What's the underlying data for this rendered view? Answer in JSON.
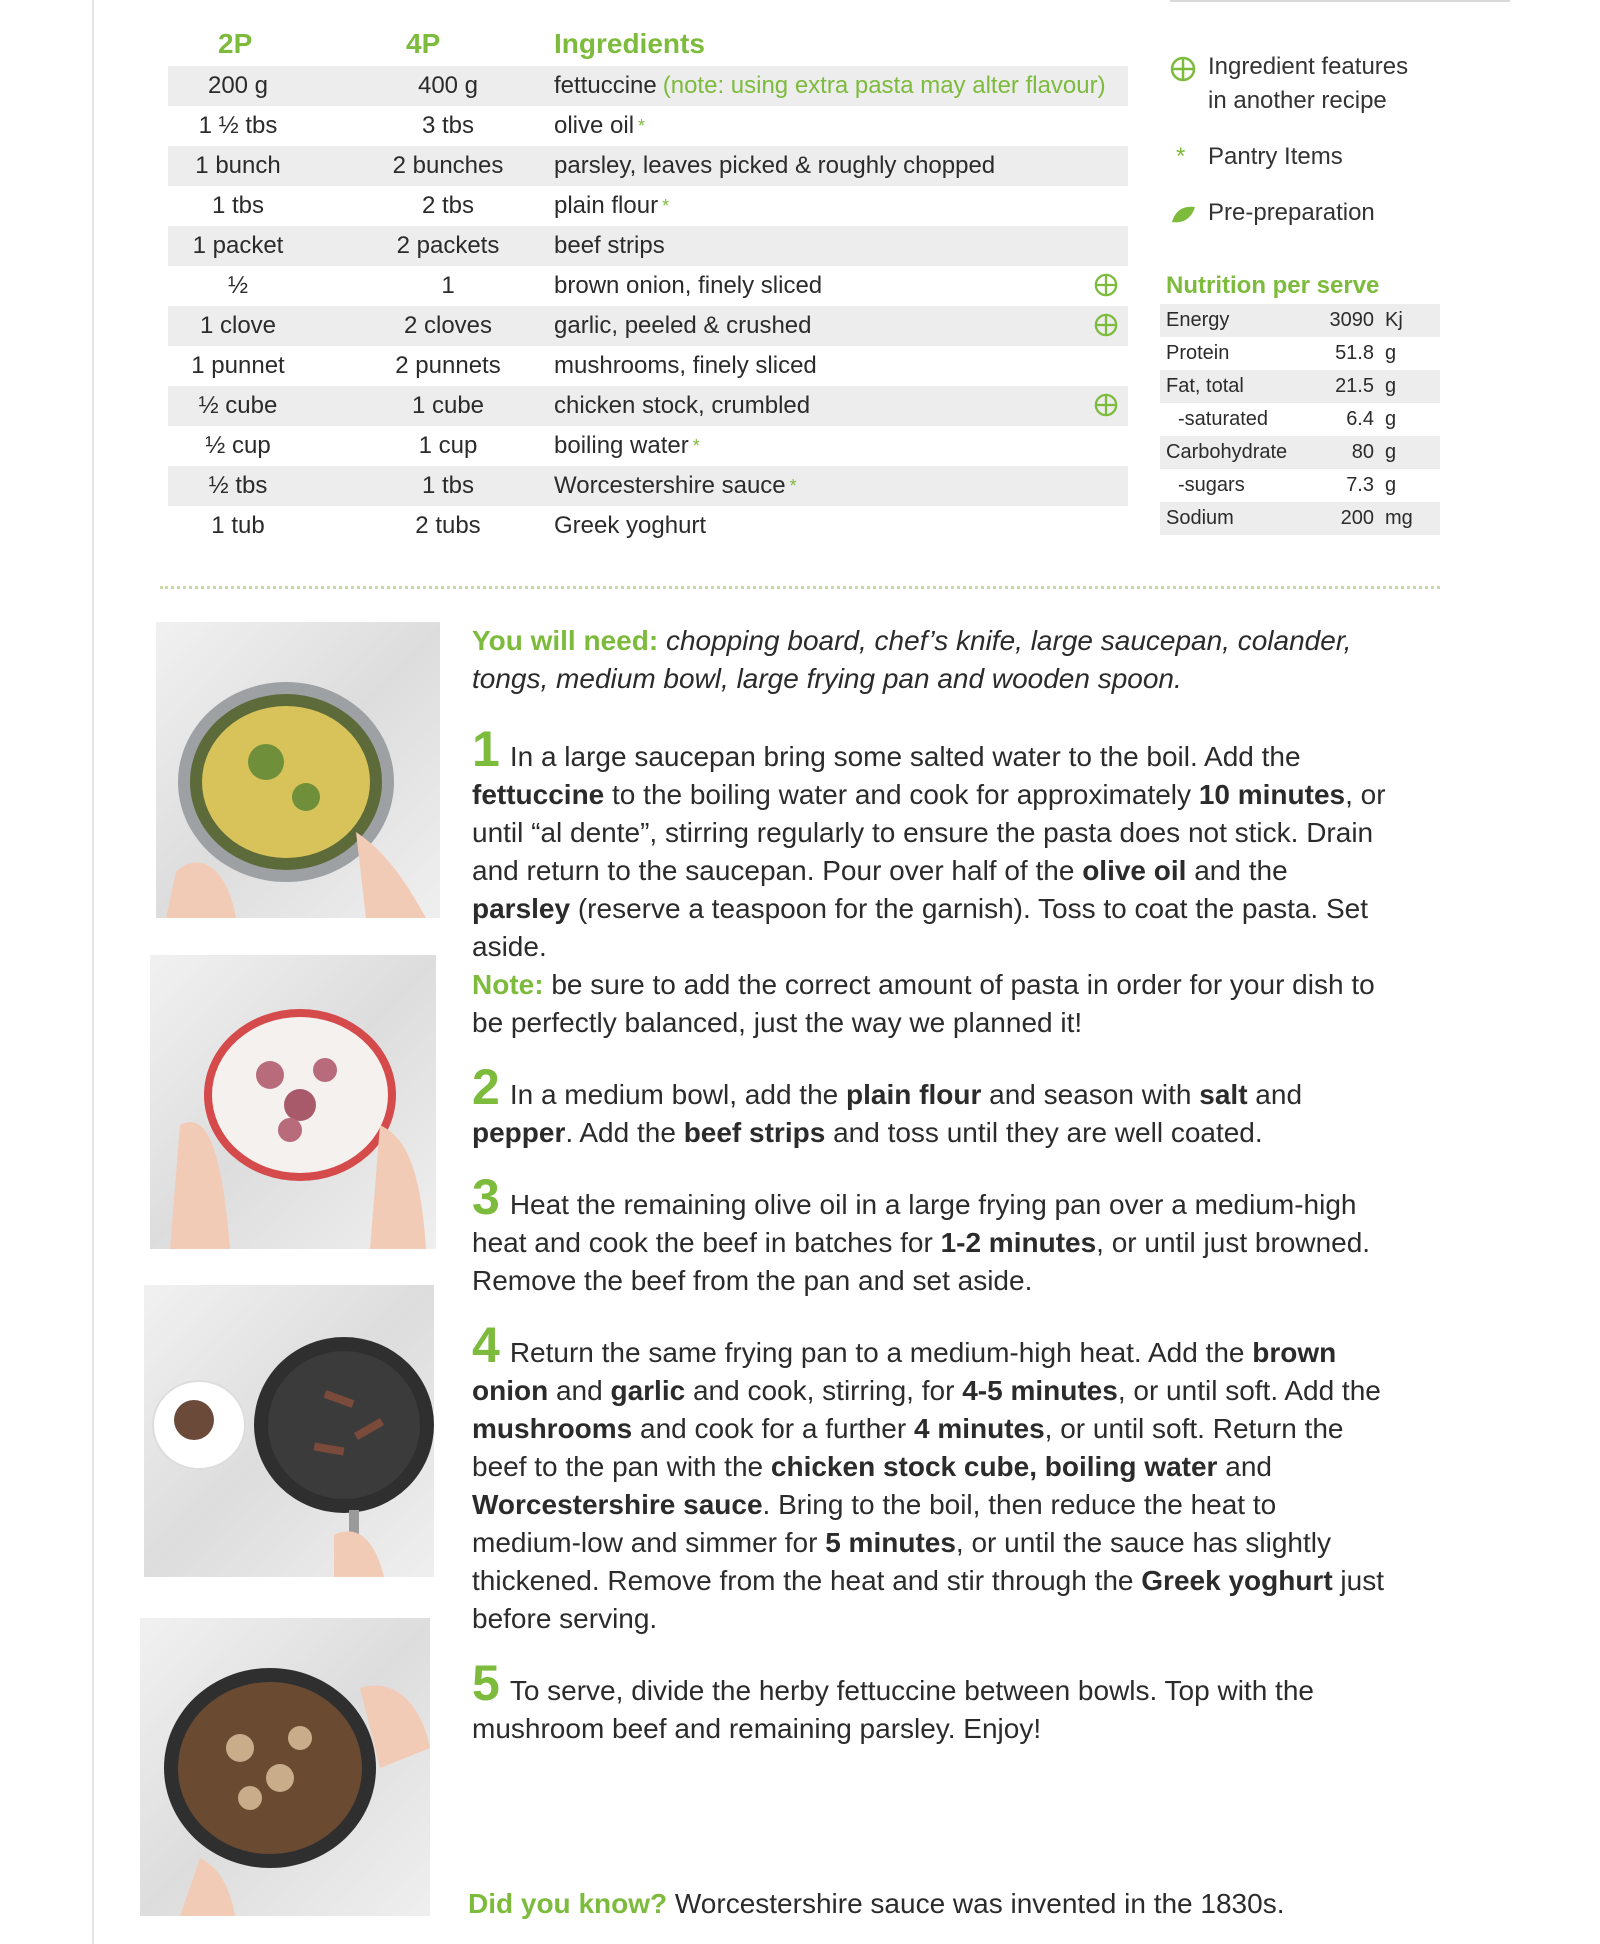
{
  "ingredients": {
    "headers": {
      "two_p": "2P",
      "four_p": "4P",
      "name": "Ingredients"
    },
    "rows": [
      {
        "two_p": "200 g",
        "four_p": "400 g",
        "name": "fettuccine",
        "note": "(note: using extra pasta may alter flavour)",
        "pantry": false,
        "feature": false
      },
      {
        "two_p": "1 ½ tbs",
        "four_p": "3 tbs",
        "name": "olive oil",
        "note": "",
        "pantry": true,
        "feature": false
      },
      {
        "two_p": "1 bunch",
        "four_p": "2 bunches",
        "name": "parsley, leaves picked & roughly chopped",
        "note": "",
        "pantry": false,
        "feature": false
      },
      {
        "two_p": "1 tbs",
        "four_p": "2 tbs",
        "name": "plain flour",
        "note": "",
        "pantry": true,
        "feature": false
      },
      {
        "two_p": "1 packet",
        "four_p": "2 packets",
        "name": "beef strips",
        "note": "",
        "pantry": false,
        "feature": false
      },
      {
        "two_p": "½",
        "four_p": "1",
        "name": "brown onion, finely sliced",
        "note": "",
        "pantry": false,
        "feature": true
      },
      {
        "two_p": "1 clove",
        "four_p": "2 cloves",
        "name": "garlic, peeled & crushed",
        "note": "",
        "pantry": false,
        "feature": true
      },
      {
        "two_p": "1 punnet",
        "four_p": "2 punnets",
        "name": "mushrooms, finely sliced",
        "note": "",
        "pantry": false,
        "feature": false
      },
      {
        "two_p": "½ cube",
        "four_p": "1 cube",
        "name": "chicken stock, crumbled",
        "note": "",
        "pantry": false,
        "feature": true
      },
      {
        "two_p": "½ cup",
        "four_p": "1 cup",
        "name": "boiling water",
        "note": "",
        "pantry": true,
        "feature": false
      },
      {
        "two_p": "½ tbs",
        "four_p": "1 tbs",
        "name": "Worcestershire sauce",
        "note": "",
        "pantry": true,
        "feature": false
      },
      {
        "two_p": "1 tub",
        "four_p": "2 tubs",
        "name": "Greek yoghurt",
        "note": "",
        "pantry": false,
        "feature": false
      }
    ]
  },
  "legend": {
    "feature_icon": "feature-cross-circle-icon",
    "feature_line1": "Ingredient features",
    "feature_line2": "in another recipe",
    "pantry_icon": "asterisk-icon",
    "pantry_label": "Pantry Items",
    "prep_icon": "leaf-icon",
    "prep_label": "Pre-preparation"
  },
  "nutrition": {
    "title": "Nutrition per serve",
    "rows": [
      {
        "label": "Energy",
        "value": "3090",
        "unit": "Kj"
      },
      {
        "label": "Protein",
        "value": "51.8",
        "unit": "g"
      },
      {
        "label": "Fat, total",
        "value": "21.5",
        "unit": "g"
      },
      {
        "label": "-saturated",
        "value": "6.4",
        "unit": "g"
      },
      {
        "label": "Carbohydrate",
        "value": "80",
        "unit": "g"
      },
      {
        "label": "-sugars",
        "value": "7.3",
        "unit": "g"
      },
      {
        "label": "Sodium",
        "value": "200",
        "unit": "mg"
      }
    ]
  },
  "photos": {
    "p1": "1",
    "p2": "2",
    "p3": "3",
    "p4": "4"
  },
  "method": {
    "need_label": "You will need:",
    "need_text": "chopping board, chef’s knife, large saucepan, colander, tongs, medium bowl, large frying pan and wooden spoon.",
    "step1": {
      "num": "1",
      "t1": "In a large saucepan bring some salted water to the boil. Add the ",
      "b1": "fettuccine",
      "t2": " to the boiling water and cook for approximately ",
      "b2": "10 minutes",
      "t3": ", or until “al dente”, stirring regularly to ensure the pasta does not stick. Drain and return to the saucepan. Pour over half of the ",
      "b3": "olive oil",
      "t4": " and the ",
      "b4": "parsley",
      "t5": " (reserve a teaspoon for the garnish). Toss to coat the pasta. Set aside.",
      "note_label": "Note:",
      "note_text": " be sure to add the correct amount of pasta in order for your dish to be perfectly balanced, just the way we planned it!"
    },
    "step2": {
      "num": "2",
      "t1": "In a medium bowl, add the ",
      "b1": "plain flour",
      "t2": " and season with ",
      "b2": "salt",
      "t3": " and ",
      "b3": "pepper",
      "t4": ". Add the ",
      "b4": "beef strips",
      "t5": " and toss until they are well coated."
    },
    "step3": {
      "num": "3",
      "t1": "Heat the remaining olive oil in a large frying pan over a medium-high heat and cook the beef in batches for ",
      "b1": "1-2 minutes",
      "t2": ", or until just browned. Remove the beef from the pan and set aside."
    },
    "step4": {
      "num": "4",
      "t1": "Return the same frying pan to a medium-high heat. Add the ",
      "b1": "brown onion",
      "t2": " and ",
      "b2": "garlic",
      "t3": " and cook, stirring, for ",
      "b3": "4-5 minutes",
      "t4": ", or until soft. Add the ",
      "b4": "mushrooms",
      "t5": " and cook for a further ",
      "b5": "4 minutes",
      "t6": ", or until soft. Return the beef to the pan with the ",
      "b6": "chicken stock cube,",
      "t7": " ",
      "b7": "boiling water",
      "t8": " and ",
      "b8": "Worcestershire sauce",
      "t9": ". Bring to the boil, then reduce the heat to medium-low and simmer for ",
      "b9": "5 minutes",
      "t10": ", or until the sauce has slightly thickened. Remove from the heat and stir through the ",
      "b10": "Greek yoghurt",
      "t11": " just before serving."
    },
    "step5": {
      "num": "5",
      "t1": "To serve, divide the herby fettuccine between bowls. Top with the mushroom beef and remaining parsley. Enjoy!"
    }
  },
  "did_you_know": {
    "label": "Did you know?",
    "text": " Worcestershire sauce was invented in the 1830s."
  }
}
